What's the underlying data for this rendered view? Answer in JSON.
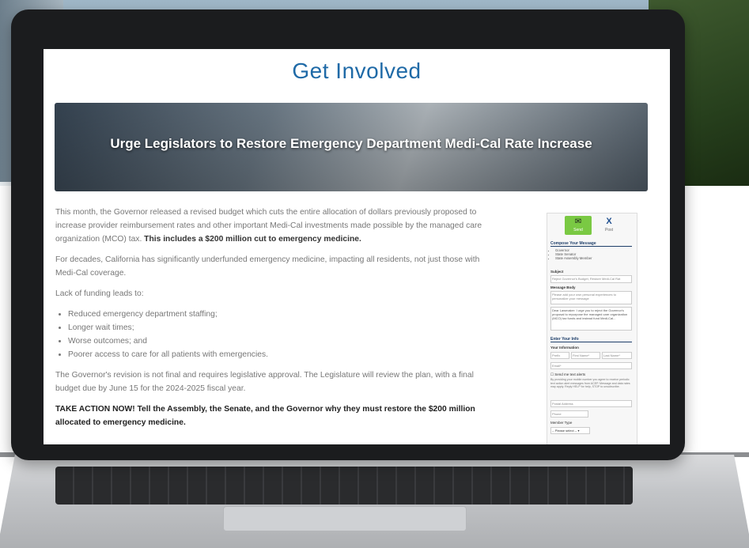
{
  "page": {
    "title": "Get Involved",
    "banner_title": "Urge Legislators to Restore Emergency Department Medi-Cal Rate Increase"
  },
  "article": {
    "p1_text": "This month, the Governor released a revised budget which cuts the entire allocation of dollars previously proposed to increase provider reimbursement rates and other important Medi-Cal investments made possible by the managed care organization (MCO) tax. ",
    "p1_bold": "This includes a $200 million cut to emergency medicine.",
    "p2": "For decades, California has significantly underfunded emergency medicine, impacting all residents, not just those with Medi-Cal coverage.",
    "p3": "Lack of funding leads to:",
    "bullets": [
      "Reduced emergency department staffing;",
      "Longer wait times;",
      "Worse outcomes; and",
      "Poorer access to care for all patients with emergencies."
    ],
    "p4": "The Governor's revision is not final and requires legislative approval. The Legislature will review the plan, with a final budget due by June 15 for the 2024-2025 fiscal year.",
    "cta": "TAKE ACTION NOW! Tell the Assembly, the Senate, and the Governor why they must restore the $200 million allocated to emergency medicine."
  },
  "form": {
    "send_label": "Send",
    "x_label": "Post",
    "compose_heading": "Compose Your Message",
    "recipients": [
      "Governor",
      "State Senator",
      "State Assembly Member"
    ],
    "subject_label": "Subject",
    "subject_value": "Reject Governor's Budget, Restore Medi-Cal Rat",
    "body_label": "Message Body",
    "body_placeholder": "Please add your own personal experiences to personalize your message",
    "body_value": "Dear Lawmaker: I urge you to reject the Governor's proposal to repurpose the managed care organization (MCO) tax funds and instead fund Medi-Cal...",
    "info_heading": "Enter Your Info",
    "your_info_label": "Your Information",
    "prefix_placeholder": "Prefix",
    "first_placeholder": "First Name*",
    "last_placeholder": "Last Name*",
    "email_placeholder": "Email*",
    "checkbox_label": "Send me text alerts",
    "disclaimer": "By providing your mobile number you agree to receive periodic text action alert messages from ACEP. Message and data rates may apply. Reply HELP for help, STOP to unsubscribe.",
    "address_placeholder": "Postal Address",
    "phone_placeholder": "Phone",
    "member_type_label": "Member Type",
    "member_type_value": "-- Please select --"
  }
}
